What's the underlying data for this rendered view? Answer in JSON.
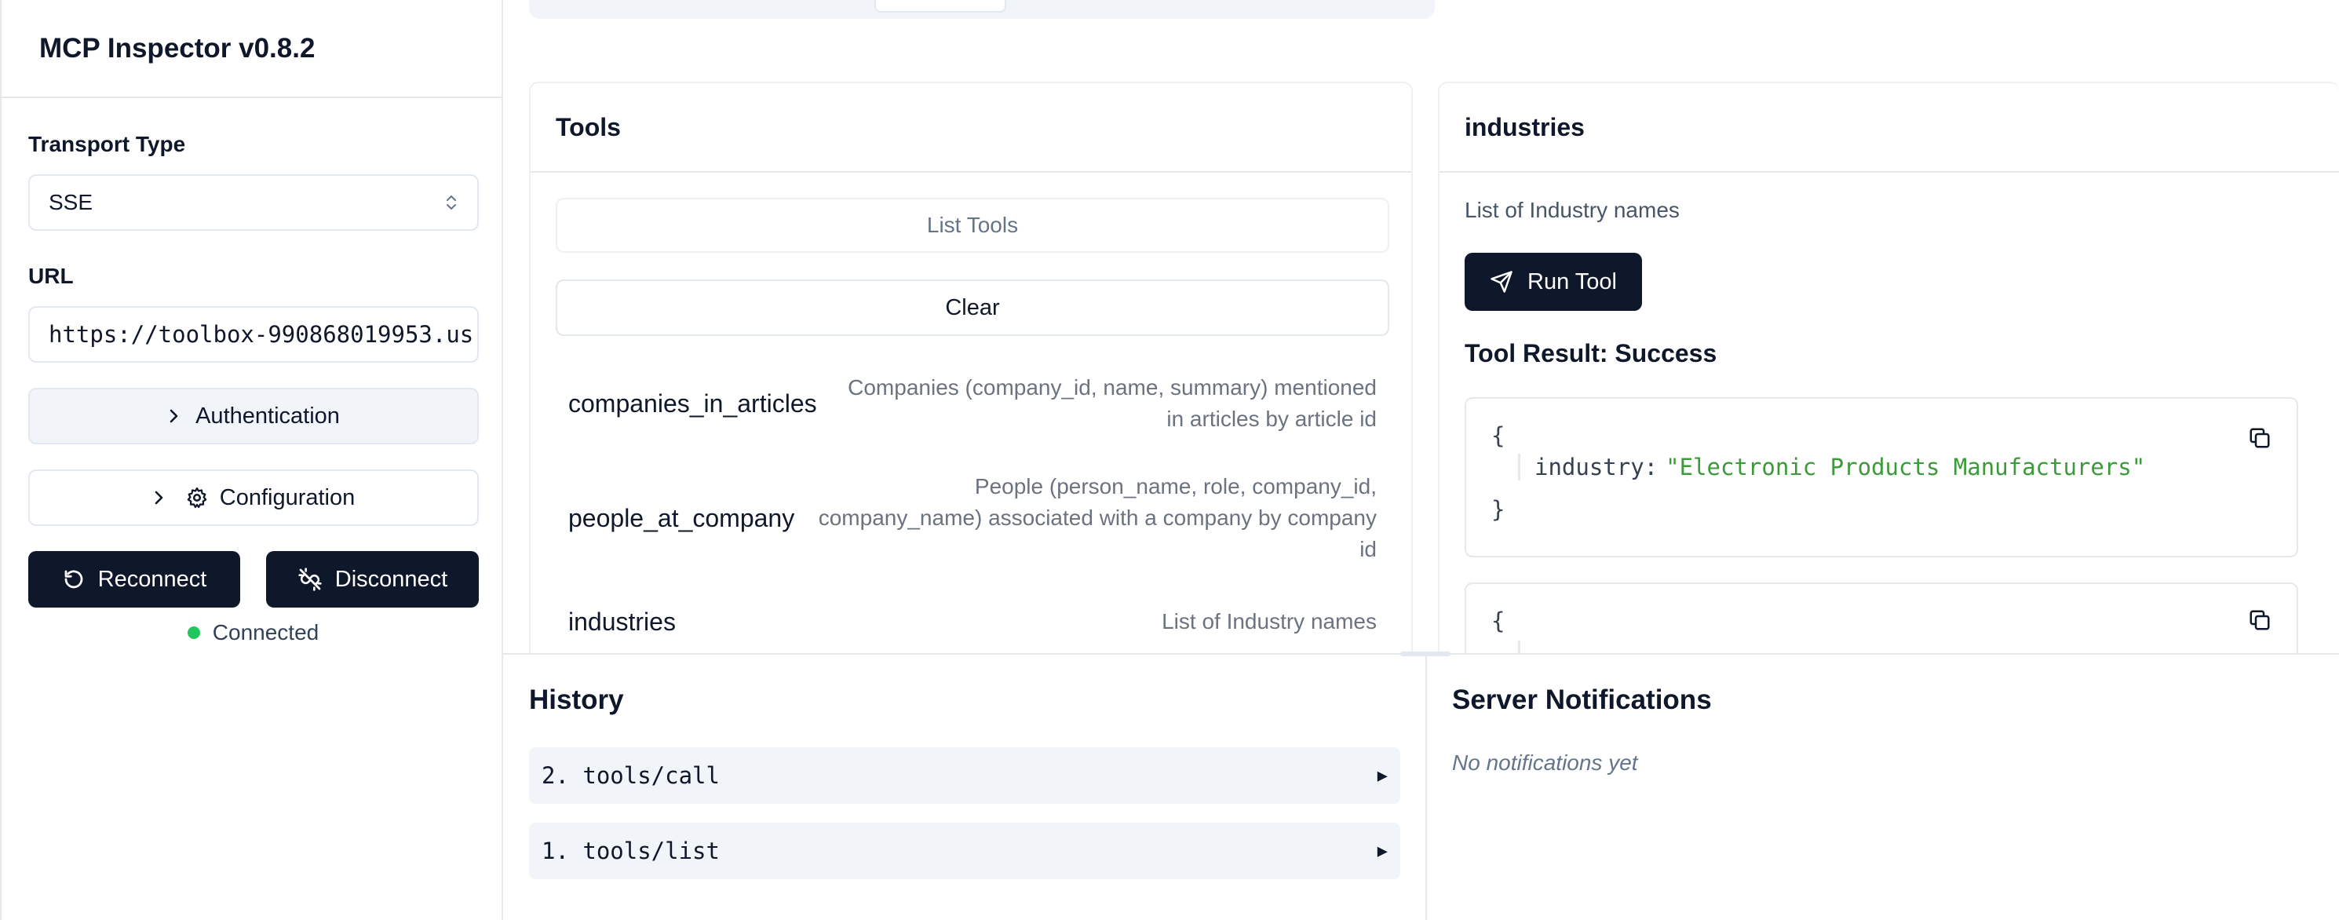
{
  "app": {
    "title": "MCP Inspector v0.8.2"
  },
  "sidebar": {
    "transport_label": "Transport Type",
    "transport_value": "SSE",
    "url_label": "URL",
    "url_value": "https://toolbox-990868019953.us",
    "authentication_label": "Authentication",
    "configuration_label": "Configuration",
    "reconnect_label": "Reconnect",
    "disconnect_label": "Disconnect",
    "status_text": "Connected",
    "status_color": "#22c55e"
  },
  "tools": {
    "title": "Tools",
    "list_tools_label": "List Tools",
    "clear_label": "Clear",
    "items": [
      {
        "name": "companies_in_articles",
        "description_lines": [
          "Companies (company_id, name, summary) mentioned",
          "in articles by article id"
        ]
      },
      {
        "name": "people_at_company",
        "description_lines": [
          "People (person_name, role, company_id,",
          "company_name) associated with a company by company",
          "id"
        ]
      },
      {
        "name": "industries",
        "description_lines": [
          "List of Industry names"
        ]
      }
    ]
  },
  "detail": {
    "title": "industries",
    "description": "List of Industry names",
    "run_tool_label": "Run Tool",
    "result_title": "Tool Result: Success",
    "results": [
      {
        "open_brace": "{",
        "key": "industry:",
        "value": "\"Electronic Products Manufacturers\"",
        "close_brace": "}"
      },
      {
        "open_brace": "{"
      }
    ]
  },
  "history": {
    "title": "History",
    "items": [
      {
        "label": "2. tools/call",
        "arrow": "▶"
      },
      {
        "label": "1. tools/list",
        "arrow": "▶"
      }
    ]
  },
  "notifications": {
    "title": "Server Notifications",
    "empty_text": "No notifications yet"
  },
  "colors": {
    "primary_dark": "#0f172a",
    "json_string": "#3c9a3a"
  }
}
